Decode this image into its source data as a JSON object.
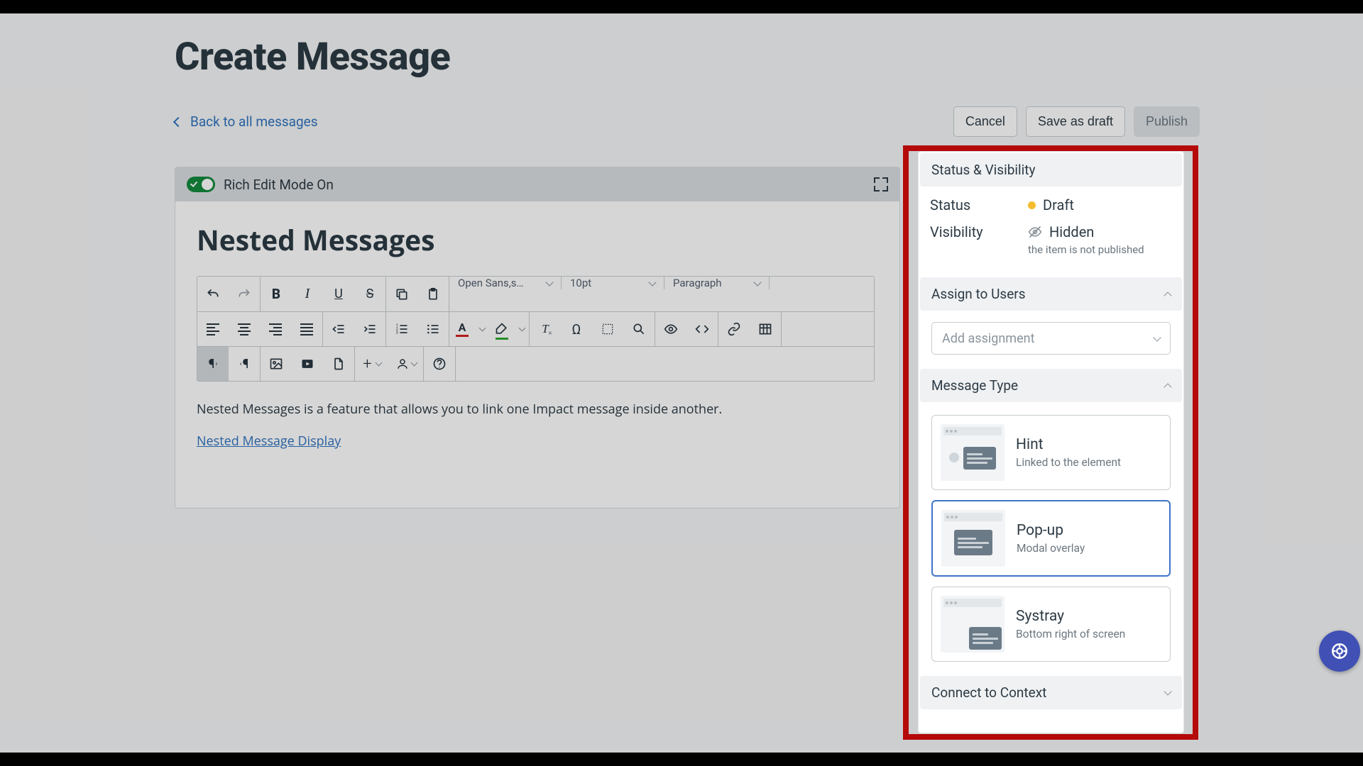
{
  "page": {
    "title": "Create Message",
    "back_link": "Back to all messages",
    "actions": {
      "cancel": "Cancel",
      "save_draft": "Save as draft",
      "publish": "Publish"
    }
  },
  "editor": {
    "mode_label": "Rich Edit Mode On",
    "heading": "Nested Messages",
    "font_family": "Open Sans,s…",
    "font_size": "10pt",
    "block_format": "Paragraph",
    "body_text": "Nested Messages is a feature that allows you to link one Impact message inside another.",
    "link_text": "Nested Message Display"
  },
  "sidebar": {
    "status_visibility": {
      "header": "Status & Visibility",
      "status_label": "Status",
      "status_value": "Draft",
      "visibility_label": "Visibility",
      "visibility_value": "Hidden",
      "visibility_note": "the item is not published"
    },
    "assign": {
      "header": "Assign to Users",
      "placeholder": "Add assignment"
    },
    "message_type": {
      "header": "Message Type",
      "options": [
        {
          "title": "Hint",
          "desc": "Linked to the element",
          "selected": false
        },
        {
          "title": "Pop-up",
          "desc": "Modal overlay",
          "selected": true
        },
        {
          "title": "Systray",
          "desc": "Bottom right of screen",
          "selected": false
        }
      ]
    },
    "connect_context": {
      "header": "Connect to Context"
    }
  }
}
